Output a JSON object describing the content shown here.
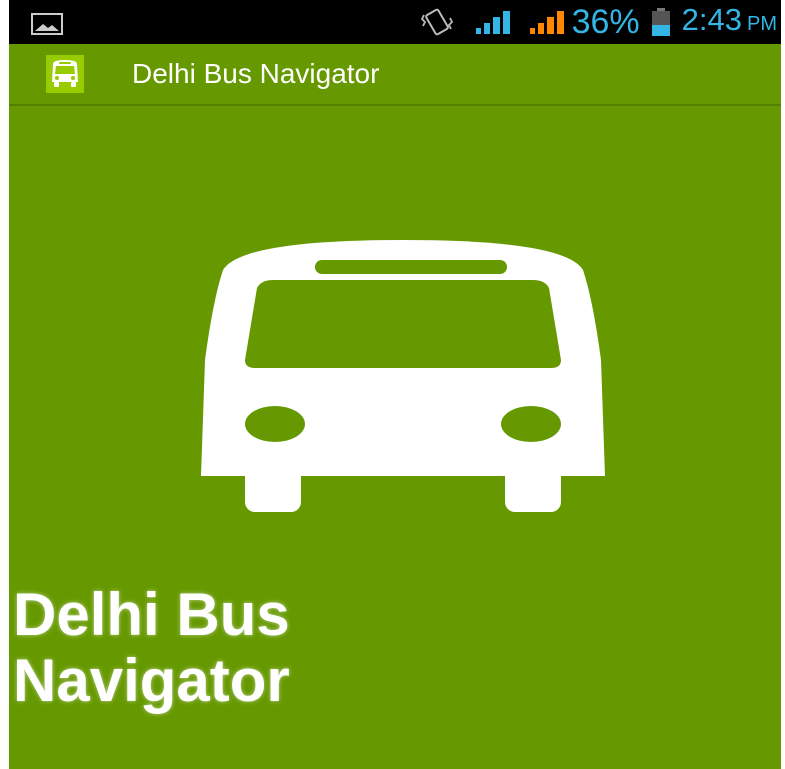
{
  "status_bar": {
    "notification_icon": "picture-icon",
    "vibrate_icon": "vibrate-icon",
    "signal_icons": [
      "signal-icon-sim1",
      "signal-icon-sim2"
    ],
    "battery_percent": "36%",
    "battery_icon": "battery-icon",
    "time": "2:43",
    "ampm": "PM",
    "colors": {
      "text": "#33b5e5",
      "signal1": "#33b5e5",
      "signal2": "#ff8800",
      "background": "#000000"
    }
  },
  "action_bar": {
    "icon": "bus-icon",
    "title": "Delhi Bus Navigator"
  },
  "splash": {
    "hero_icon": "bus-icon",
    "title_line1": "Delhi Bus",
    "title_line2": "Navigator"
  },
  "theme": {
    "background": "#669900",
    "foreground": "#ffffff"
  }
}
